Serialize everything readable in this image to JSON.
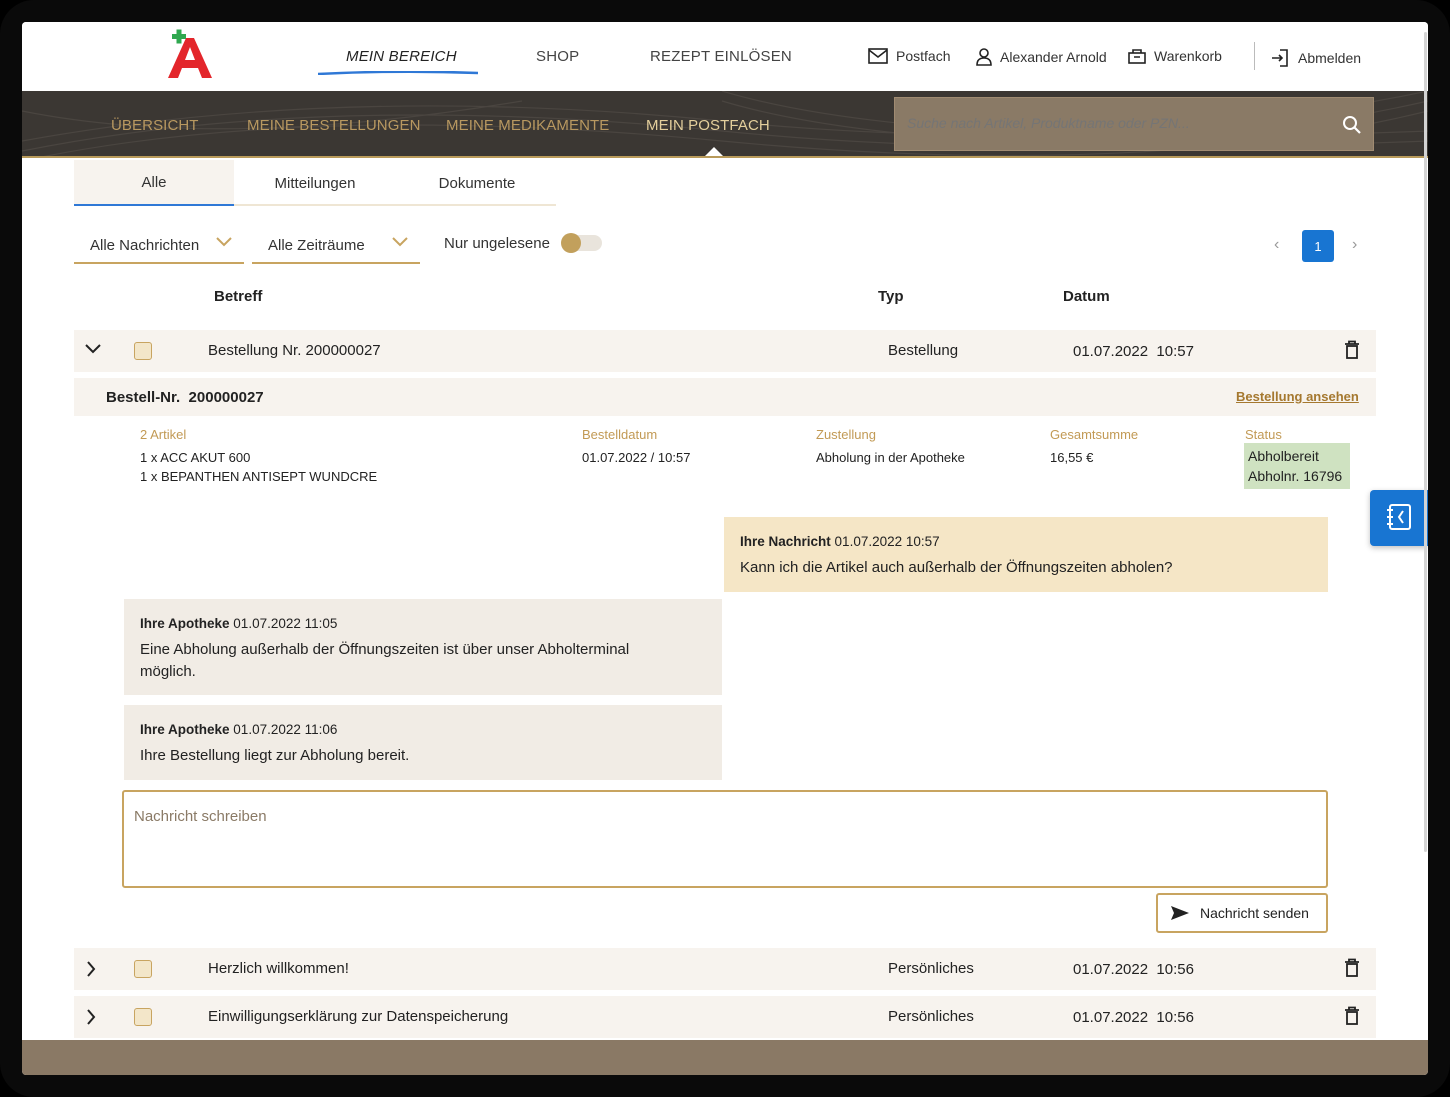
{
  "header": {
    "nav": [
      "MEIN BEREICH",
      "SHOP",
      "REZEPT EINLÖSEN"
    ],
    "postfach": "Postfach",
    "user": "Alexander Arnold",
    "cart": "Warenkorb",
    "logout": "Abmelden"
  },
  "subnav": {
    "items": [
      "ÜBERSICHT",
      "MEINE BESTELLUNGEN",
      "MEINE MEDIKAMENTE",
      "MEIN POSTFACH"
    ],
    "search_placeholder": "Suche nach Artikel, Produktname oder PZN..."
  },
  "tabs": [
    "Alle",
    "Mitteilungen",
    "Dokumente"
  ],
  "filters": {
    "messages": "Alle Nachrichten",
    "period": "Alle Zeiträume",
    "unread_label": "Nur ungelesene",
    "page": "1"
  },
  "table_headers": {
    "subject": "Betreff",
    "type": "Typ",
    "date": "Datum"
  },
  "rows": [
    {
      "subject": "Bestellung Nr. 200000027",
      "type": "Bestellung",
      "date": "01.07.2022",
      "time": "10:57"
    },
    {
      "subject": "Herzlich willkommen!",
      "type": "Persönliches",
      "date": "01.07.2022",
      "time": "10:56"
    },
    {
      "subject": "Einwilligungserklärung zur Datenspeicherung",
      "type": "Persönliches",
      "date": "01.07.2022",
      "time": "10:56"
    }
  ],
  "order": {
    "label": "Bestell-Nr.",
    "number": "200000027",
    "view_link": "Bestellung ansehen",
    "articles_label": "2 Artikel",
    "articles": [
      "1 x ACC AKUT 600",
      "1 x BEPANTHEN ANTISEPT WUNDCRE"
    ],
    "orderdate_label": "Bestelldatum",
    "orderdate": "01.07.2022 / 10:57",
    "delivery_label": "Zustellung",
    "delivery": "Abholung in der Apotheke",
    "total_label": "Gesamtsumme",
    "total": "16,55 €",
    "status_label": "Status",
    "status": [
      "Abholbereit",
      "Abholnr. 16796"
    ]
  },
  "messages": [
    {
      "author": "Ihre Nachricht",
      "timestamp": "01.07.2022  10:57",
      "text": "Kann ich die Artikel auch außerhalb der Öffnungszeiten abholen?"
    },
    {
      "author": "Ihre Apotheke",
      "timestamp": "01.07.2022  11:05",
      "text": "Eine Abholung außerhalb der Öffnungszeiten ist über unser Abholterminal möglich."
    },
    {
      "author": "Ihre Apotheke",
      "timestamp": "01.07.2022  11:06",
      "text": "Ihre Bestellung liegt zur Abholung bereit."
    }
  ],
  "compose": {
    "placeholder": "Nachricht schreiben",
    "send": "Nachricht senden"
  },
  "colors": {
    "brand_red": "#e3262b",
    "brand_green": "#2fa84f",
    "accent_gold": "#c8a460",
    "primary_blue": "#1875d2",
    "band_dark": "#3b3733"
  }
}
